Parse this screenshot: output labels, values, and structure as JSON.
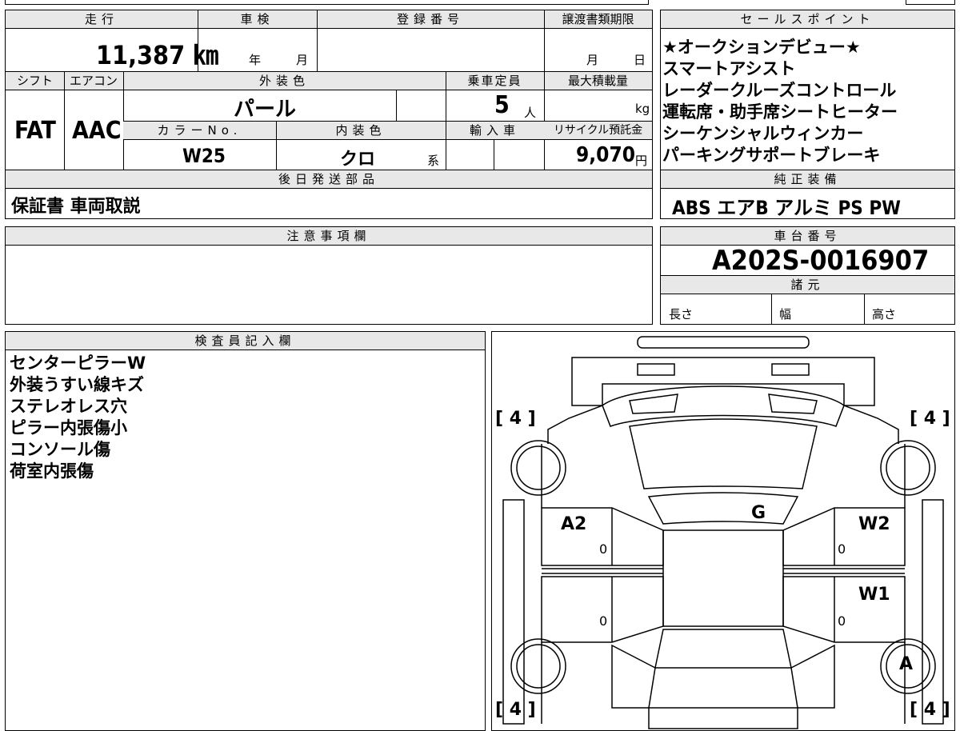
{
  "sheet": {
    "mileage": {
      "label": "走行",
      "value": "11,387 ㎞"
    },
    "shaken": {
      "label": "車検",
      "year": "年",
      "month": "月"
    },
    "registration": {
      "label": "登録番号",
      "value": ""
    },
    "transfer_deadline": {
      "label": "譲渡書類期限",
      "month": "月",
      "day": "日"
    },
    "shift": {
      "label": "シフト",
      "value": "FAT"
    },
    "aircon": {
      "label": "エアコン",
      "value": "AAC"
    },
    "exterior_color": {
      "label": "外装色",
      "value": "パール"
    },
    "capacity": {
      "label": "乗車定員",
      "value": "5",
      "unit": "人"
    },
    "max_load": {
      "label": "最大積載量",
      "unit": "kg"
    },
    "color_no": {
      "label": "カラーNo.",
      "value": "W25"
    },
    "interior_color": {
      "label": "内装色",
      "value": "クロ",
      "unit": "系"
    },
    "import": {
      "label": "輸入車"
    },
    "recycle_fee": {
      "label": "リサイクル預託金",
      "value": "9,070",
      "unit": "円"
    },
    "later_parts": {
      "label": "後日発送部品",
      "value": "保証書 車両取説"
    },
    "notes": {
      "label": "注意事項欄"
    }
  },
  "sales_points": {
    "label": "セールスポイント",
    "items": [
      "★オークションデビュー★",
      "スマートアシスト",
      "レーダークルーズコントロール",
      "運転席・助手席シートヒーター",
      "シーケンシャルウィンカー",
      "パーキングサポートブレーキ"
    ]
  },
  "equipment": {
    "label": "純正装備",
    "value": "ABS エアB アルミ PS PW"
  },
  "chassis": {
    "label": "車台番号",
    "value": "A202S-0016907"
  },
  "specs": {
    "label": "諸元",
    "length": "長さ",
    "width": "幅",
    "height": "高さ"
  },
  "inspector": {
    "label": "検査員記入欄",
    "items": [
      "センターピラーW",
      "外装うすい線キズ",
      "ステレオレス穴",
      "ピラー内張傷小",
      "コンソール傷",
      "荷室内張傷"
    ]
  },
  "diagram": {
    "tire_fl": "[ 4 ]",
    "tire_fr": "[ 4 ]",
    "tire_rl": "[ 4 ]",
    "tire_rr": "[ 4 ]",
    "mark_a2": "A2",
    "mark_g": "G",
    "mark_w2": "W2",
    "mark_w1": "W1",
    "mark_a": "A",
    "zero": "0"
  }
}
